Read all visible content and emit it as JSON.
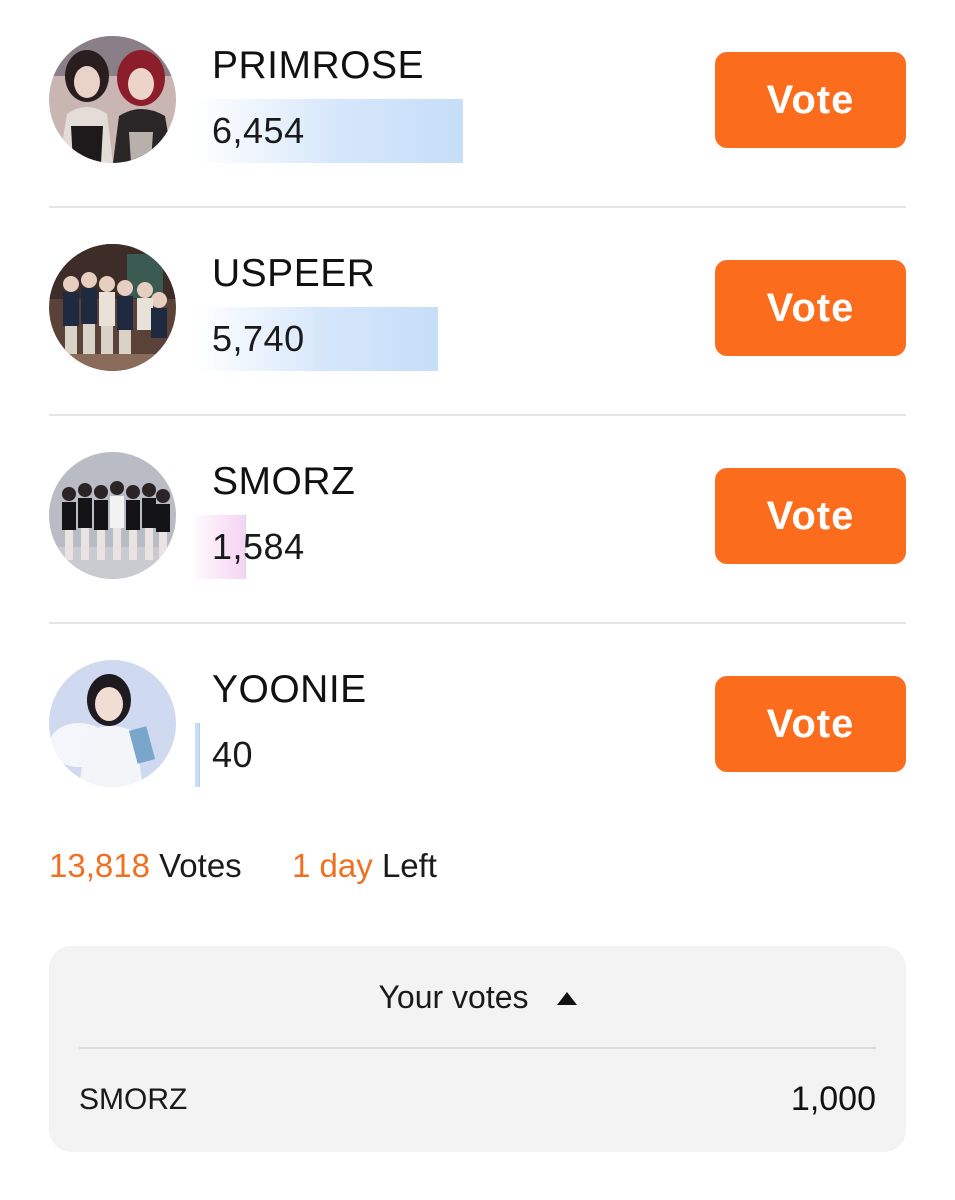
{
  "candidates": [
    {
      "name": "PRIMROSE",
      "votes": "6,454",
      "vote_count": 6454,
      "bar_color": "blue",
      "vote_label": "Vote"
    },
    {
      "name": "USPEER",
      "votes": "5,740",
      "vote_count": 5740,
      "bar_color": "blue",
      "vote_label": "Vote"
    },
    {
      "name": "SMORZ",
      "votes": "1,584",
      "vote_count": 1584,
      "bar_color": "pink",
      "vote_label": "Vote"
    },
    {
      "name": "YOONIE",
      "votes": "40",
      "vote_count": 40,
      "bar_color": "blue",
      "vote_label": "Vote"
    }
  ],
  "summary": {
    "total_votes": "13,818",
    "votes_label": "Votes",
    "time_left": "1 day",
    "left_label": "Left"
  },
  "your_votes": {
    "header": "Your votes",
    "items": [
      {
        "name": "SMORZ",
        "value": "1,000"
      }
    ]
  },
  "colors": {
    "accent": "#fb6c1c",
    "accent_text": "#f0701f",
    "bar_blue": "#c6def8",
    "bar_pink": "#f6d4f2",
    "panel_bg": "#f3f3f4"
  },
  "icons": {
    "caret": "caret-up-icon"
  }
}
